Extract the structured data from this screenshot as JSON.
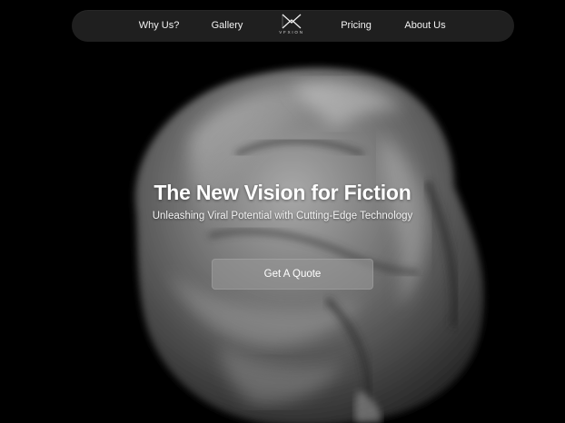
{
  "nav": {
    "links": [
      {
        "label": "Why Us?"
      },
      {
        "label": "Gallery"
      },
      {
        "label": "Pricing"
      },
      {
        "label": "About Us"
      }
    ],
    "logo_text": "VFXION"
  },
  "hero": {
    "title": "The New Vision for Fiction",
    "subtitle": "Unleashing Viral Potential with Cutting-Edge Technology",
    "cta_label": "Get A Quote",
    "background_image": "abstract-fabric-sculpture"
  },
  "colors": {
    "background": "#000000",
    "navbar": "#1f1f1f",
    "text": "#ffffff",
    "button": "#8a8a8a"
  }
}
